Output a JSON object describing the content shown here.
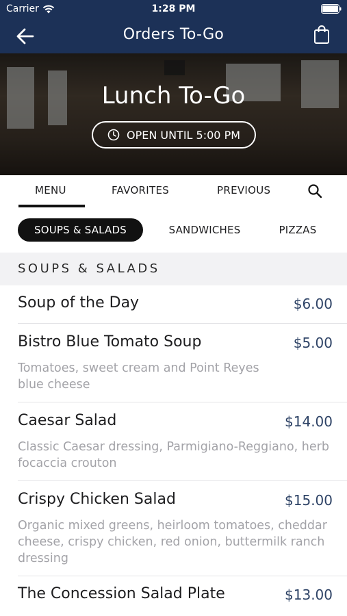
{
  "status": {
    "carrier": "Carrier",
    "time": "1:28 PM"
  },
  "nav": {
    "title": "Orders To-Go",
    "back_icon": "arrow-left-icon",
    "bag_icon": "shopping-bag-icon"
  },
  "hero": {
    "title": "Lunch To-Go",
    "hours": "OPEN UNTIL 5:00 PM"
  },
  "tabs": [
    {
      "label": "MENU",
      "active": true
    },
    {
      "label": "FAVORITES"
    },
    {
      "label": "PREVIOUS"
    }
  ],
  "categories": [
    {
      "label": "SOUPS & SALADS",
      "active": true
    },
    {
      "label": "SANDWICHES"
    },
    {
      "label": "PIZZAS"
    }
  ],
  "section": {
    "title": "SOUPS & SALADS"
  },
  "items": [
    {
      "name": "Soup of the Day",
      "price": "$6.00",
      "desc_lines": []
    },
    {
      "name": "Bistro Blue Tomato Soup",
      "price": "$5.00",
      "desc_lines": [
        "Tomatoes, sweet cream and Point Reyes",
        "blue cheese"
      ]
    },
    {
      "name": "Caesar Salad",
      "price": "$14.00",
      "desc_lines": [
        "Classic Caesar dressing, Parmigiano-Reggiano, herb",
        "focaccia crouton"
      ]
    },
    {
      "name": "Crispy Chicken Salad",
      "price": "$15.00",
      "desc_lines": [
        "Organic mixed greens, heirloom tomatoes, cheddar",
        "cheese, crispy chicken, red onion, buttermilk ranch",
        "dressing"
      ]
    },
    {
      "name": "The Concession Salad Plate",
      "price": "$13.00",
      "desc_lines": []
    }
  ],
  "colors": {
    "navbar": "#1c3157",
    "price": "#2e4366",
    "active_pill": "#111111"
  }
}
